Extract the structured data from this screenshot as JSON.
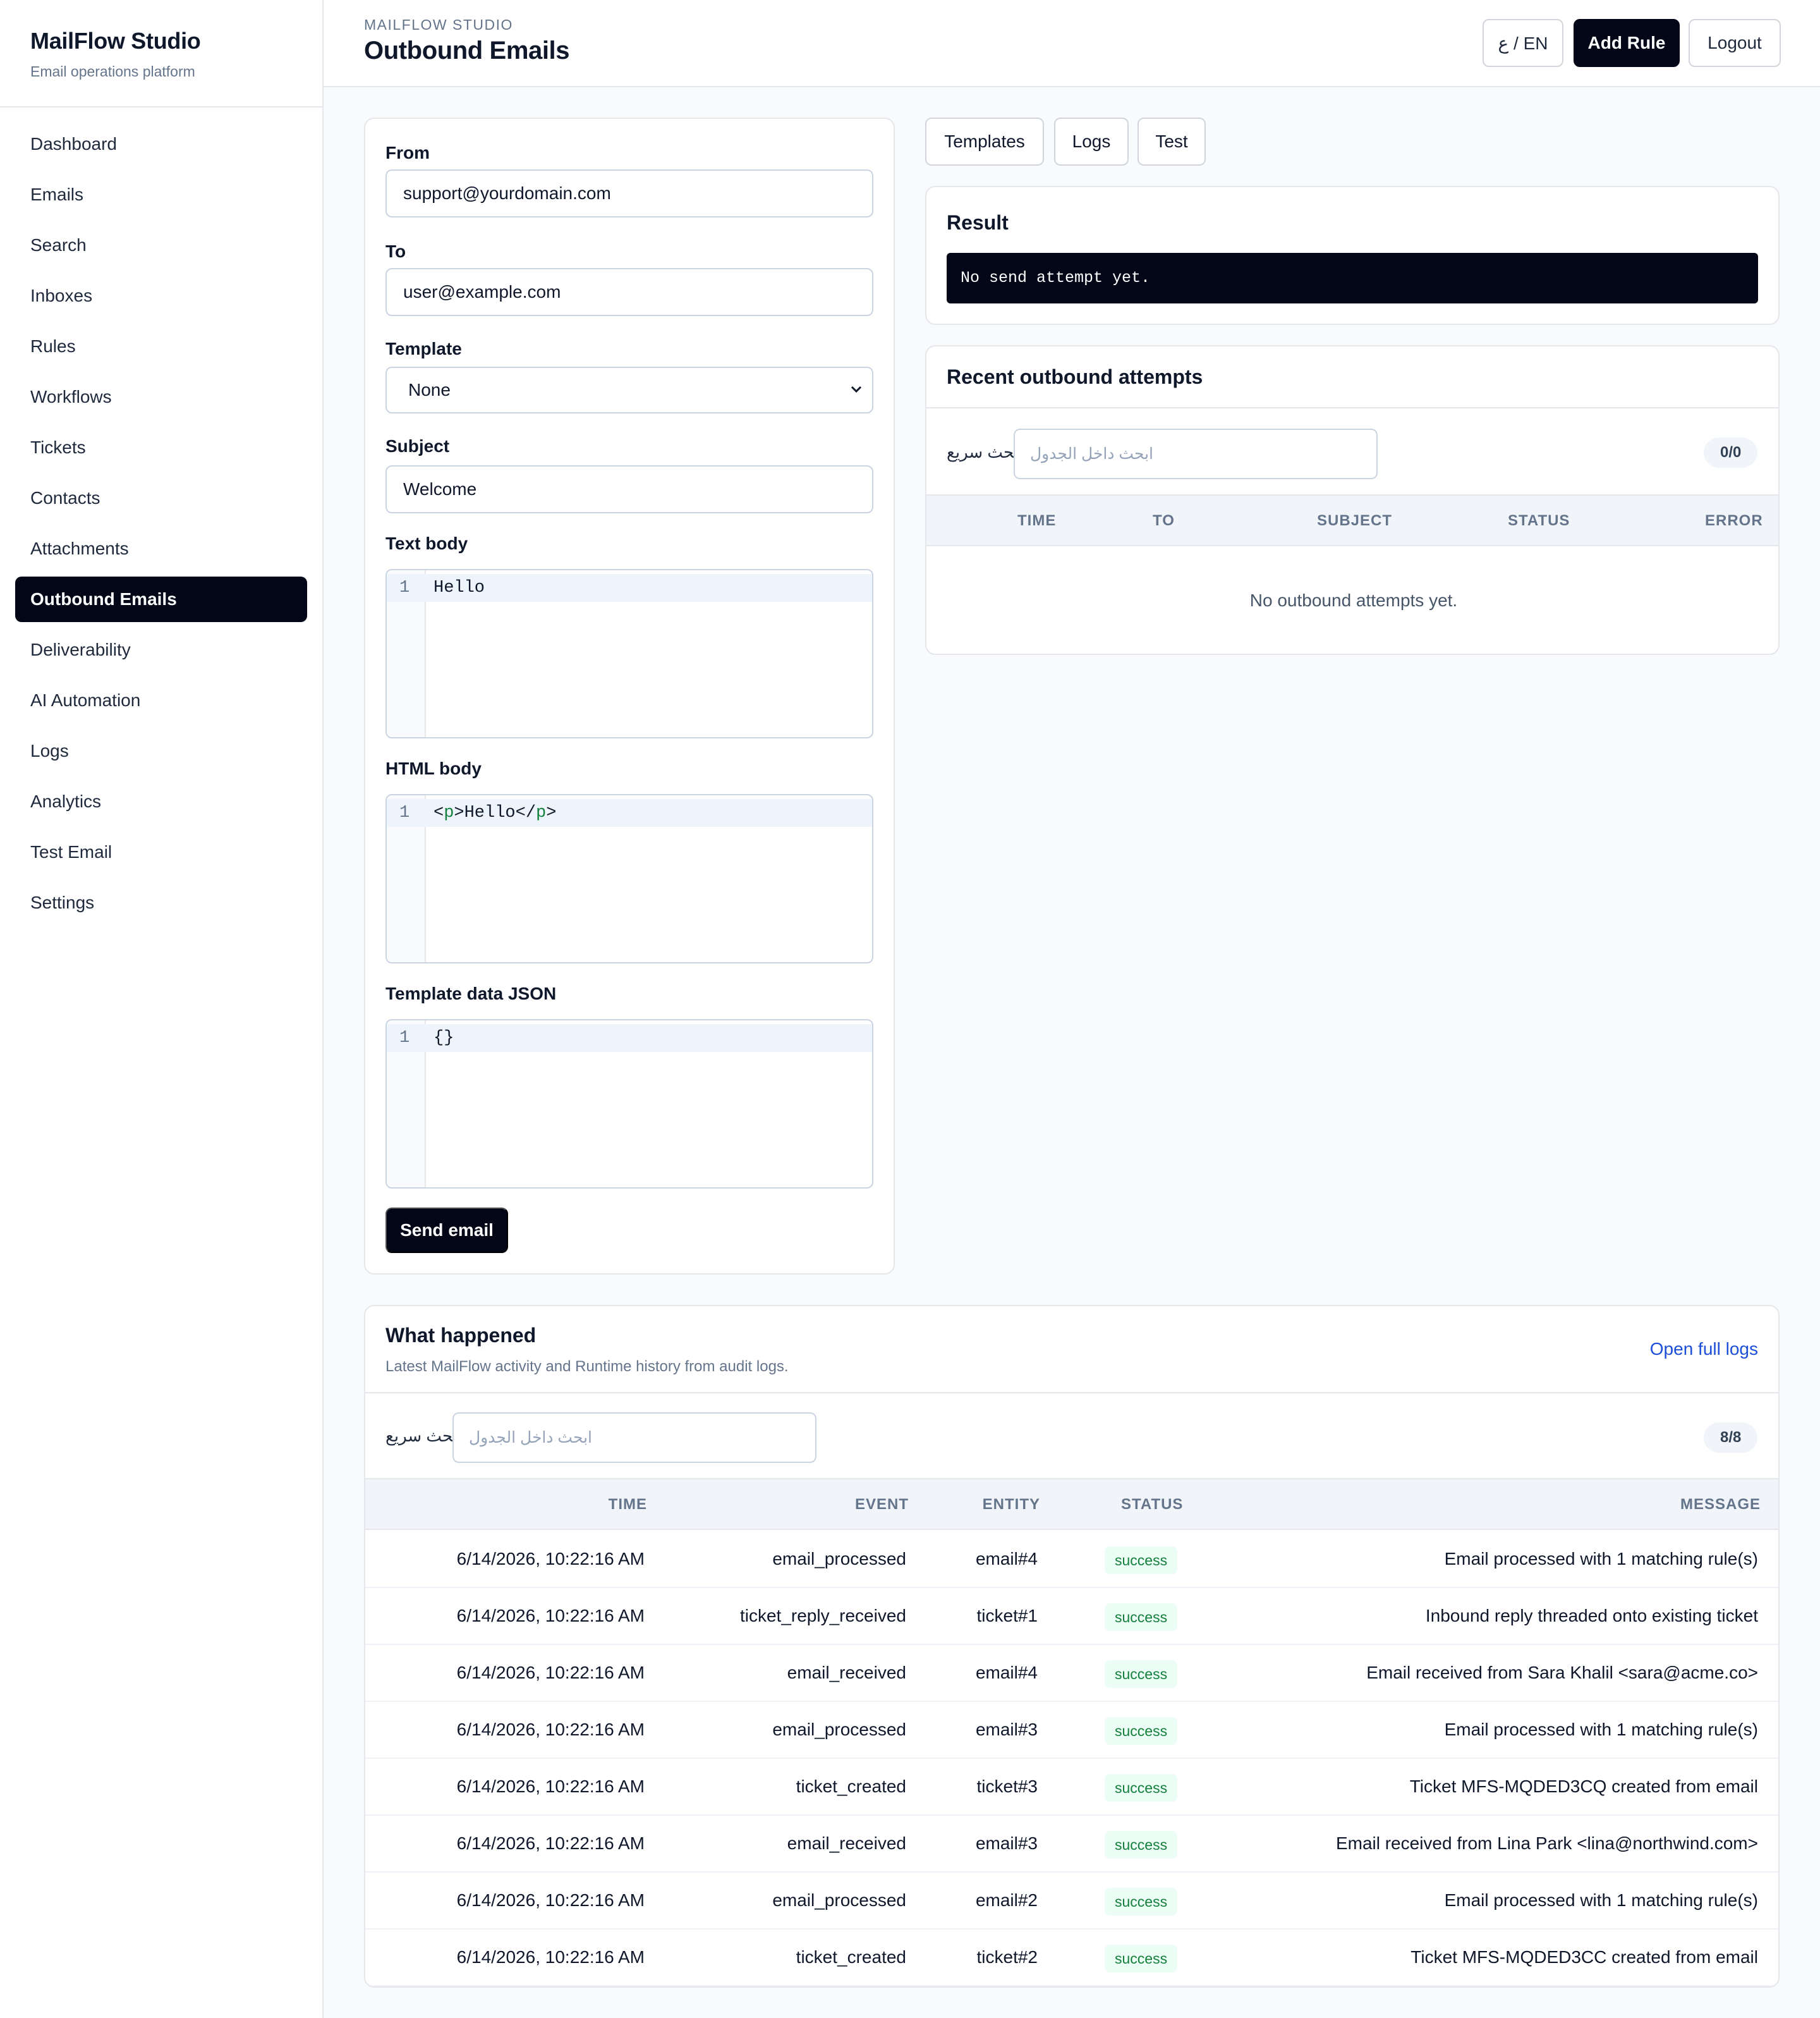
{
  "sidebar": {
    "brand_title": "MailFlow Studio",
    "brand_subtitle": "Email operations platform",
    "items": [
      {
        "label": "Dashboard"
      },
      {
        "label": "Emails"
      },
      {
        "label": "Search"
      },
      {
        "label": "Inboxes"
      },
      {
        "label": "Rules"
      },
      {
        "label": "Workflows"
      },
      {
        "label": "Tickets"
      },
      {
        "label": "Contacts"
      },
      {
        "label": "Attachments"
      },
      {
        "label": "Outbound Emails",
        "active": true
      },
      {
        "label": "Deliverability"
      },
      {
        "label": "AI Automation"
      },
      {
        "label": "Logs"
      },
      {
        "label": "Analytics"
      },
      {
        "label": "Test Email"
      },
      {
        "label": "Settings"
      }
    ]
  },
  "header": {
    "eyebrow": "MAILFLOW STUDIO",
    "title": "Outbound Emails",
    "lang_button": "ع / EN",
    "add_rule": "Add Rule",
    "logout": "Logout"
  },
  "form": {
    "from_label": "From",
    "from_value": "support@yourdomain.com",
    "to_label": "To",
    "to_value": "user@example.com",
    "template_label": "Template",
    "template_value": "None",
    "subject_label": "Subject",
    "subject_value": "Welcome",
    "text_body_label": "Text body",
    "text_body_line_no": "1",
    "text_body_value": "Hello",
    "html_body_label": "HTML body",
    "html_body_line_no": "1",
    "html_body_open_tag_lt": "<",
    "html_body_open_tag": "p",
    "html_body_mid": ">Hello</",
    "html_body_close_tag": "p",
    "html_body_end": ">",
    "json_label": "Template data JSON",
    "json_line_no": "1",
    "json_value": "{}",
    "send_button": "Send email"
  },
  "tabs": [
    {
      "label": "Templates"
    },
    {
      "label": "Logs"
    },
    {
      "label": "Test"
    }
  ],
  "result": {
    "title": "Result",
    "output": "No send attempt yet."
  },
  "recent": {
    "title": "Recent outbound attempts",
    "quick_search_label": "بحث سريع",
    "quick_search_placeholder": "ابحث داخل الجدول",
    "count": "0/0",
    "columns": [
      "TIME",
      "TO",
      "SUBJECT",
      "STATUS",
      "ERROR"
    ],
    "empty": "No outbound attempts yet."
  },
  "happened": {
    "title": "What happened",
    "subtitle": "Latest MailFlow activity and Runtime history from audit logs.",
    "open_logs": "Open full logs",
    "quick_search_label": "بحث سريع",
    "quick_search_placeholder": "ابحث داخل الجدول",
    "count": "8/8",
    "columns": [
      "TIME",
      "EVENT",
      "ENTITY",
      "STATUS",
      "MESSAGE"
    ],
    "rows": [
      {
        "time": "6/14/2026, 10:22:16 AM",
        "event": "email_processed",
        "entity": "email#4",
        "status": "success",
        "message": "Email processed with 1 matching rule(s)"
      },
      {
        "time": "6/14/2026, 10:22:16 AM",
        "event": "ticket_reply_received",
        "entity": "ticket#1",
        "status": "success",
        "message": "Inbound reply threaded onto existing ticket"
      },
      {
        "time": "6/14/2026, 10:22:16 AM",
        "event": "email_received",
        "entity": "email#4",
        "status": "success",
        "message": "Email received from Sara Khalil <sara@acme.co>"
      },
      {
        "time": "6/14/2026, 10:22:16 AM",
        "event": "email_processed",
        "entity": "email#3",
        "status": "success",
        "message": "Email processed with 1 matching rule(s)"
      },
      {
        "time": "6/14/2026, 10:22:16 AM",
        "event": "ticket_created",
        "entity": "ticket#3",
        "status": "success",
        "message": "Ticket MFS-MQDED3CQ created from email"
      },
      {
        "time": "6/14/2026, 10:22:16 AM",
        "event": "email_received",
        "entity": "email#3",
        "status": "success",
        "message": "Email received from Lina Park <lina@northwind.com>"
      },
      {
        "time": "6/14/2026, 10:22:16 AM",
        "event": "email_processed",
        "entity": "email#2",
        "status": "success",
        "message": "Email processed with 1 matching rule(s)"
      },
      {
        "time": "6/14/2026, 10:22:16 AM",
        "event": "ticket_created",
        "entity": "ticket#2",
        "status": "success",
        "message": "Ticket MFS-MQDED3CC created from email"
      }
    ]
  },
  "colors": {
    "accent_dark": "#020617",
    "success_text": "#15803d",
    "success_bg": "#ecfdf5",
    "link": "#1d4ed8"
  }
}
